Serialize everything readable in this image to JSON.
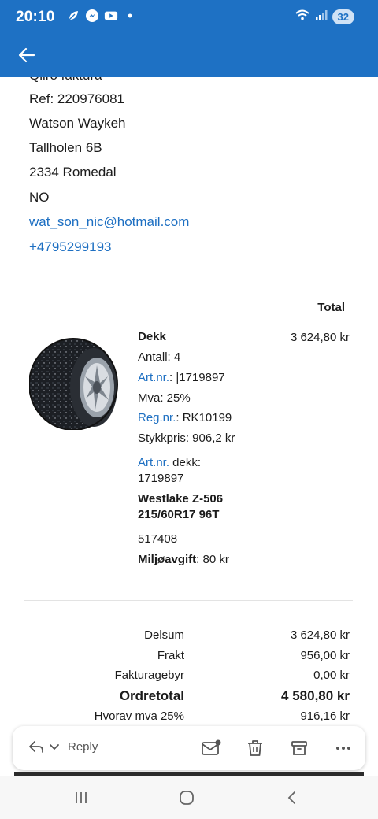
{
  "status_bar": {
    "time": "20:10",
    "battery": "32",
    "icons_left": [
      "leaf-icon",
      "messenger-icon",
      "youtube-icon",
      "dot-icon"
    ],
    "icons_right": [
      "wifi-icon",
      "signal-icon"
    ]
  },
  "app_bar": {
    "back_icon": "arrow-left-icon"
  },
  "address": {
    "cut_line": "Qliro faktura",
    "ref": "Ref: 220976081",
    "name": "Watson Waykeh",
    "street": "Tallholen 6B",
    "postal": "2334 Romedal",
    "country": "NO",
    "email": "wat_son_nic@hotmail.com",
    "phone": "+4795299193"
  },
  "order": {
    "total_header": "Total",
    "item": {
      "title": "Dekk",
      "quantity": "Antall: 4",
      "artnr_label": "Art.nr.",
      "artnr_value": ": |1719897",
      "vat": "Mva: 25%",
      "regnr_label": "Reg.nr.",
      "regnr_value": ": RK10199",
      "unit_price": "Stykkpris: 906,2 kr",
      "artnr_dekk_label": "Art.nr.",
      "artnr_dekk_suffix": " dekk:",
      "artnr_dekk_value": "1719897",
      "model_line1": "Westlake Z-506",
      "model_line2": "215/60R17 96T",
      "code": "517408",
      "env_fee_label": "Miljøavgift",
      "env_fee_value": ": 80 kr",
      "price": "3 624,80 kr"
    }
  },
  "summary": {
    "subtotal_label": "Delsum",
    "subtotal_value": "3 624,80 kr",
    "shipping_label": "Frakt",
    "shipping_value": "956,00 kr",
    "fee_label": "Fakturagebyr",
    "fee_value": "0,00 kr",
    "total_label": "Ordretotal",
    "total_value": "4 580,80 kr",
    "vat_label": "Hvorav mva 25%",
    "vat_value": "916,16 kr"
  },
  "action_bar": {
    "reply_label": "Reply",
    "icons": [
      "reply-icon",
      "chevron-down-icon",
      "mark-unread-icon",
      "delete-icon",
      "archive-icon",
      "more-icon"
    ]
  },
  "nav_bar": {
    "icons": [
      "recents-icon",
      "home-icon",
      "back-icon"
    ]
  },
  "colors": {
    "brand_blue": "#1e71c4",
    "link_blue": "#1d6fc2"
  }
}
